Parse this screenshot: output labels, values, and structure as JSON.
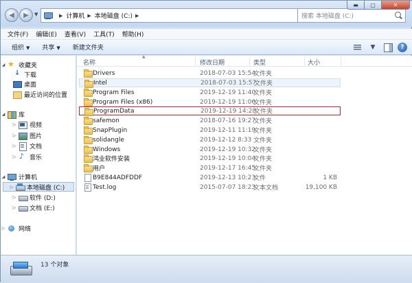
{
  "address": {
    "segments": [
      "计算机",
      "本地磁盘 (C:)"
    ],
    "search_placeholder": "搜索 本地磁盘 (C:)"
  },
  "window_controls": {
    "minimize": "▬",
    "maximize": "▢",
    "close": "✕"
  },
  "menu": [
    "文件(F)",
    "编辑(E)",
    "查看(V)",
    "工具(T)",
    "帮助(H)"
  ],
  "commands": {
    "organize": "组织",
    "share": "共享",
    "new_folder": "新建文件夹"
  },
  "columns": {
    "name": "名称",
    "date": "修改日期",
    "type": "类型",
    "size": "大小"
  },
  "nav": {
    "favorites": {
      "label": "收藏夹",
      "items": [
        "下载",
        "桌面",
        "最近访问的位置"
      ]
    },
    "libraries": {
      "label": "库",
      "items": [
        "视频",
        "图片",
        "文档",
        "音乐"
      ]
    },
    "computer": {
      "label": "计算机",
      "items": [
        "本地磁盘 (C:)",
        "软件 (D:)",
        "文档 (E:)"
      ]
    },
    "network": {
      "label": "网络"
    }
  },
  "files": [
    {
      "name": "Drivers",
      "date": "2018-07-03 15:54",
      "type": "文件夹",
      "size": "",
      "kind": "folder"
    },
    {
      "name": "Intel",
      "date": "2018-07-03 15:57",
      "type": "文件夹",
      "size": "",
      "kind": "folder"
    },
    {
      "name": "Program Files",
      "date": "2019-12-19 11:40",
      "type": "文件夹",
      "size": "",
      "kind": "folder"
    },
    {
      "name": "Program Files (x86)",
      "date": "2019-12-19 11:06",
      "type": "文件夹",
      "size": "",
      "kind": "folder"
    },
    {
      "name": "ProgramData",
      "date": "2019-12-19 14:28",
      "type": "文件夹",
      "size": "",
      "kind": "folder"
    },
    {
      "name": "safemon",
      "date": "2018-07-16 19:27",
      "type": "文件夹",
      "size": "",
      "kind": "folder"
    },
    {
      "name": "SnapPlugin",
      "date": "2019-12-11 11:19",
      "type": "文件夹",
      "size": "",
      "kind": "folder"
    },
    {
      "name": "solidangle",
      "date": "2019-12-12 8:33",
      "type": "文件夹",
      "size": "",
      "kind": "folder"
    },
    {
      "name": "Windows",
      "date": "2019-12-19 10:32",
      "type": "文件夹",
      "size": "",
      "kind": "folder"
    },
    {
      "name": "鸿业软件安装",
      "date": "2019-12-19 10:04",
      "type": "文件夹",
      "size": "",
      "kind": "folder"
    },
    {
      "name": "用户",
      "date": "2019-12-17 16:45",
      "type": "文件夹",
      "size": "",
      "kind": "folder"
    },
    {
      "name": "B9E844ADFDDF",
      "date": "2019-12-13 10:23",
      "type": "文件",
      "size": "1 KB",
      "kind": "file"
    },
    {
      "name": "Test.log",
      "date": "2015-07-07 18:23",
      "type": "文本文档",
      "size": "19,100 KB",
      "kind": "text"
    }
  ],
  "status": {
    "count": "13 个对象"
  },
  "colors": {
    "highlight_frame": "#c0232c",
    "selection": "#dbe8f8",
    "hover": "#eef4fc"
  }
}
